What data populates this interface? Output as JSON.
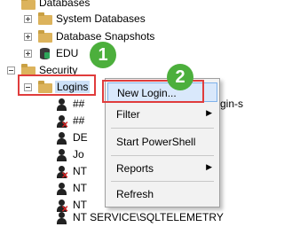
{
  "tree": {
    "databases_label": "Databases",
    "system_databases_label": "System Databases",
    "database_snapshots_label": "Database Snapshots",
    "edu_label": "EDU",
    "security_label": "Security",
    "logins_label": "Logins",
    "login_rows": [
      {
        "text": "##"
      },
      {
        "text": "##"
      },
      {
        "text": "DE"
      },
      {
        "text": "Jo"
      },
      {
        "text": "NT"
      },
      {
        "text": "NT"
      },
      {
        "text": "NT"
      },
      {
        "text": "NT SERVICE\\SQLTELEMETRY"
      }
    ],
    "partial_right_text": "gin-s"
  },
  "context_menu": {
    "items": [
      {
        "label": "New Login...",
        "has_submenu": false
      },
      {
        "label": "Filter",
        "has_submenu": true
      },
      {
        "label": "Start PowerShell",
        "has_submenu": false
      },
      {
        "label": "Reports",
        "has_submenu": true
      },
      {
        "label": "Refresh",
        "has_submenu": false
      }
    ]
  },
  "callouts": {
    "step1": "1",
    "step2": "2"
  },
  "colors": {
    "callout_green": "#4caf3c",
    "highlight_red": "#e03c3c",
    "folder_yellow": "#dcb35c"
  }
}
